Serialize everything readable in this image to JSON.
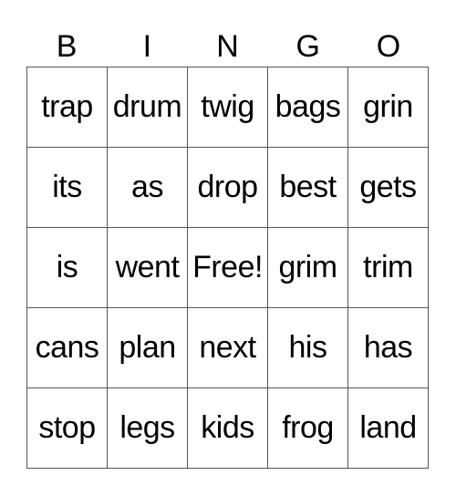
{
  "header": [
    "B",
    "I",
    "N",
    "G",
    "O"
  ],
  "cells": [
    [
      "trap",
      "drum",
      "twig",
      "bags",
      "grin"
    ],
    [
      "its",
      "as",
      "drop",
      "best",
      "gets"
    ],
    [
      "is",
      "went",
      "Free!",
      "grim",
      "trim"
    ],
    [
      "cans",
      "plan",
      "next",
      "his",
      "has"
    ],
    [
      "stop",
      "legs",
      "kids",
      "frog",
      "land"
    ]
  ]
}
